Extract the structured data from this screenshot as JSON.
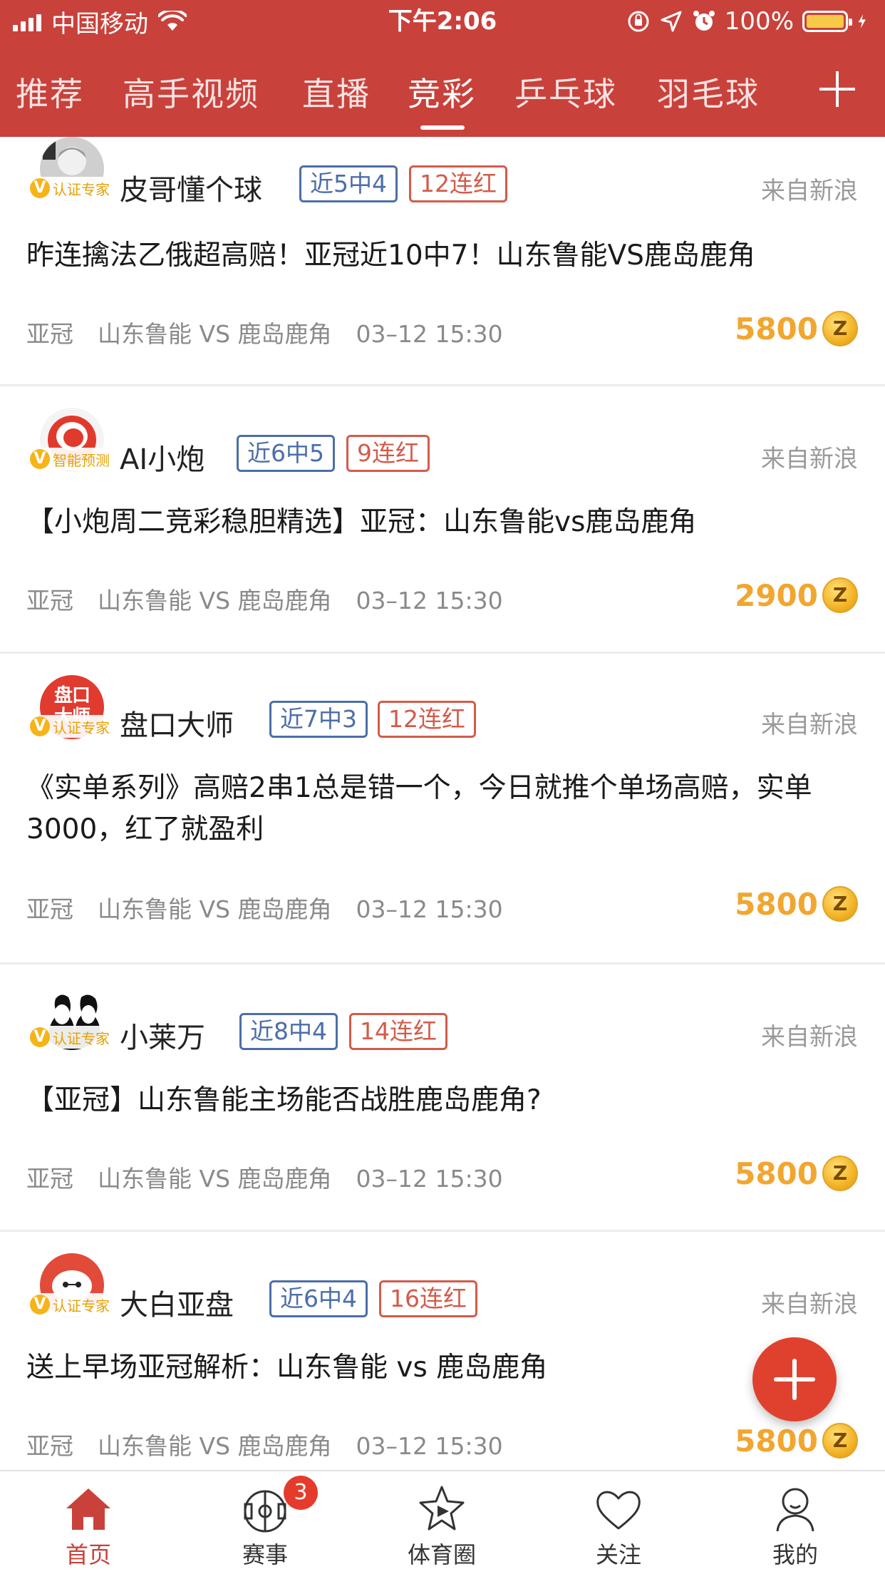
{
  "status_bar": {
    "carrier": "中国移动",
    "time": "下午2:06",
    "battery": "100%"
  },
  "tabs": [
    {
      "label": "推荐",
      "active": false
    },
    {
      "label": "高手视频",
      "active": false
    },
    {
      "label": "直播",
      "active": false
    },
    {
      "label": "竞彩",
      "active": true
    },
    {
      "label": "乒乓球",
      "active": false
    },
    {
      "label": "羽毛球",
      "active": false
    }
  ],
  "posts": [
    {
      "author": "皮哥懂个球",
      "badge": "认证专家",
      "record": "近5中4",
      "streak": "12连红",
      "source": "来自新浪",
      "title": "昨连擒法乙俄超高赔！亚冠近10中7！山东鲁能VS鹿岛鹿角",
      "league": "亚冠",
      "match": "山东鲁能 VS 鹿岛鹿角",
      "datetime": "03–12 15:30",
      "price": "5800",
      "coin": "Z"
    },
    {
      "author": "AI小炮",
      "badge": "智能预测",
      "record": "近6中5",
      "streak": "9连红",
      "source": "来自新浪",
      "title": "【小炮周二竞彩稳胆精选】亚冠：山东鲁能vs鹿岛鹿角",
      "league": "亚冠",
      "match": "山东鲁能 VS 鹿岛鹿角",
      "datetime": "03–12 15:30",
      "price": "2900",
      "coin": "Z"
    },
    {
      "author": "盘口大师",
      "badge": "认证专家",
      "avatar_text": "盘口大师",
      "record": "近7中3",
      "streak": "12连红",
      "source": "来自新浪",
      "title": "《实单系列》高赔2串1总是错一个，今日就推个单场高赔，实单3000，红了就盈利",
      "league": "亚冠",
      "match": "山东鲁能 VS 鹿岛鹿角",
      "datetime": "03–12 15:30",
      "price": "5800",
      "coin": "Z"
    },
    {
      "author": "小莱万",
      "badge": "认证专家",
      "record": "近8中4",
      "streak": "14连红",
      "source": "来自新浪",
      "title": "【亚冠】山东鲁能主场能否战胜鹿岛鹿角?",
      "league": "亚冠",
      "match": "山东鲁能 VS 鹿岛鹿角",
      "datetime": "03–12 15:30",
      "price": "5800",
      "coin": "Z"
    },
    {
      "author": "大白亚盘",
      "badge": "认证专家",
      "record": "近6中4",
      "streak": "16连红",
      "source": "来自新浪",
      "title": "送上早场亚冠解析：山东鲁能 vs 鹿岛鹿角",
      "league": "亚冠",
      "match": "山东鲁能 VS 鹿岛鹿角",
      "datetime": "03–12 15:30",
      "price": "5800",
      "coin": "Z"
    }
  ],
  "bottom_nav": [
    {
      "label": "首页",
      "icon": "home-icon",
      "active": true
    },
    {
      "label": "赛事",
      "icon": "soccer-field-icon",
      "badge": "3"
    },
    {
      "label": "体育圈",
      "icon": "star-play-icon"
    },
    {
      "label": "关注",
      "icon": "heart-icon"
    },
    {
      "label": "我的",
      "icon": "person-icon"
    }
  ],
  "colors": {
    "header": "#c9413b",
    "record_tag": "#4c6ea8",
    "streak_tag": "#d35b4a",
    "price": "#f1a630",
    "fab": "#e0412e",
    "verify": "#f5b417"
  }
}
